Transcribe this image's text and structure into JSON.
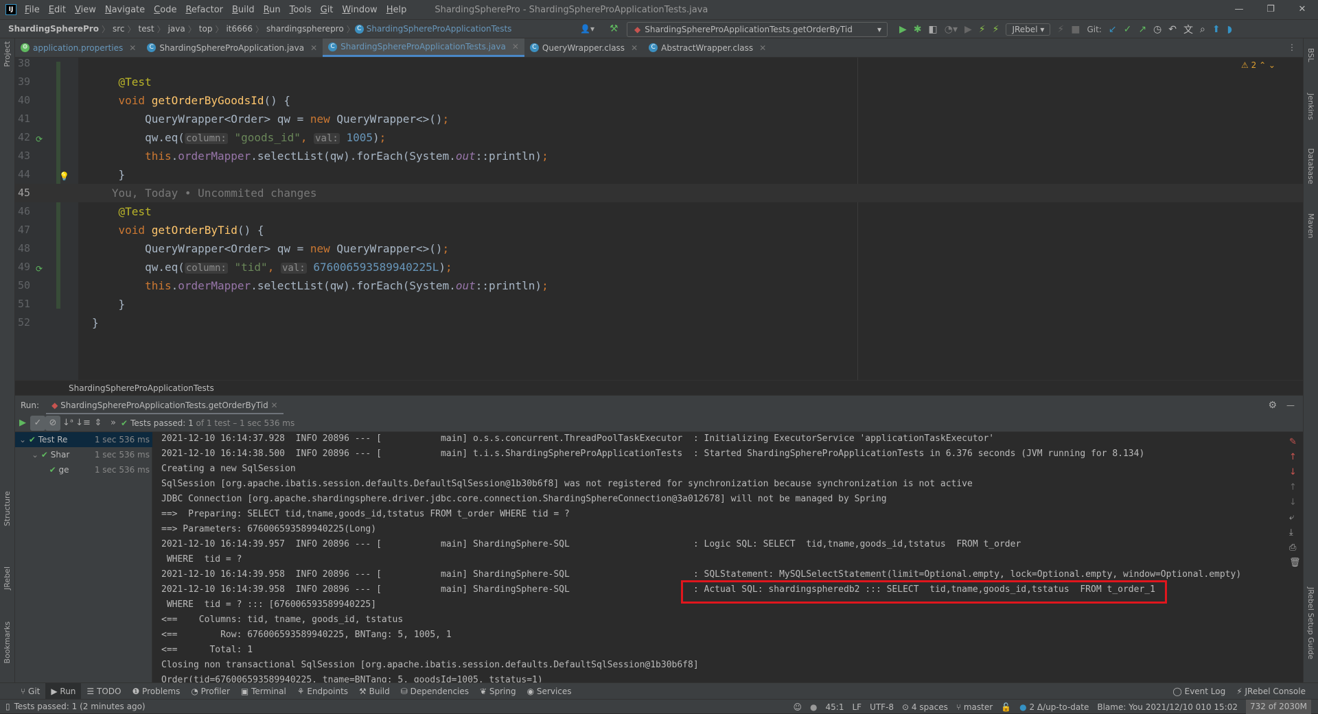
{
  "app": {
    "logo": "IJ",
    "title": "ShardingSpherePro - ShardingSphereProApplicationTests.java"
  },
  "menu": [
    "File",
    "Edit",
    "View",
    "Navigate",
    "Code",
    "Refactor",
    "Build",
    "Run",
    "Tools",
    "Git",
    "Window",
    "Help"
  ],
  "breadcrumb": [
    "ShardingSpherePro",
    "src",
    "test",
    "java",
    "top",
    "it6666",
    "shardingspherepro",
    "ShardingSphereProApplicationTests"
  ],
  "run_config": "ShardingSphereProApplicationTests.getOrderByTid",
  "jrebel_label": "JRebel",
  "git_label": "Git:",
  "tabs": [
    {
      "label": "application.properties",
      "active": false
    },
    {
      "label": "ShardingSphereProApplication.java",
      "active": false
    },
    {
      "label": "ShardingSphereProApplicationTests.java",
      "active": true
    },
    {
      "label": "QueryWrapper.class",
      "active": false
    },
    {
      "label": "AbstractWrapper.class",
      "active": false
    }
  ],
  "left_stripe": [
    "Project",
    "Structure",
    "JRebel",
    "Bookmarks"
  ],
  "right_stripe": [
    "BSL",
    "Jenkins",
    "Database",
    "Maven",
    "JRebel Setup Guide"
  ],
  "editor": {
    "warnings": "2",
    "caret_line": 45,
    "lines": [
      {
        "n": 38,
        "tokens": []
      },
      {
        "n": 39,
        "tokens": [
          [
            "    ",
            ""
          ],
          [
            "@Test",
            "a"
          ]
        ]
      },
      {
        "n": 40,
        "tokens": [
          [
            "    ",
            ""
          ],
          [
            "void ",
            "k"
          ],
          [
            "getOrderByGoodsId",
            "m"
          ],
          [
            "() {",
            ""
          ]
        ]
      },
      {
        "n": 41,
        "tokens": [
          [
            "        QueryWrapper<Order> qw = ",
            ""
          ],
          [
            "new ",
            "k"
          ],
          [
            "QueryWrapper<>()",
            ""
          ],
          [
            ";",
            "k"
          ]
        ]
      },
      {
        "n": 42,
        "tokens": [
          [
            "        qw.eq(",
            ""
          ],
          [
            "column:",
            "h"
          ],
          [
            " ",
            ""
          ],
          [
            "\"goods_id\"",
            "s"
          ],
          [
            ", ",
            "k"
          ],
          [
            "val:",
            "h"
          ],
          [
            " ",
            ""
          ],
          [
            "1005",
            "n"
          ],
          [
            ")",
            ""
          ],
          [
            ";",
            "k"
          ]
        ]
      },
      {
        "n": 43,
        "tokens": [
          [
            "        ",
            ""
          ],
          [
            "this",
            "k"
          ],
          [
            ".",
            ""
          ],
          [
            "orderMapper",
            "f"
          ],
          [
            ".selectList(qw).forEach(System.",
            ""
          ],
          [
            "out",
            "fi"
          ],
          [
            "::println)",
            ""
          ],
          [
            ";",
            "k"
          ]
        ]
      },
      {
        "n": 44,
        "tokens": [
          [
            "    }",
            ""
          ]
        ]
      },
      {
        "n": 45,
        "tokens": [
          [
            "   You, Today • Uncommited changes",
            "b"
          ]
        ]
      },
      {
        "n": 46,
        "tokens": [
          [
            "    ",
            ""
          ],
          [
            "@Test",
            "a"
          ]
        ]
      },
      {
        "n": 47,
        "tokens": [
          [
            "    ",
            ""
          ],
          [
            "void ",
            "k"
          ],
          [
            "getOrderByTid",
            "m"
          ],
          [
            "() {",
            ""
          ]
        ]
      },
      {
        "n": 48,
        "tokens": [
          [
            "        QueryWrapper<Order> qw = ",
            ""
          ],
          [
            "new ",
            "k"
          ],
          [
            "QueryWrapper<>()",
            ""
          ],
          [
            ";",
            "k"
          ]
        ]
      },
      {
        "n": 49,
        "tokens": [
          [
            "        qw.eq(",
            ""
          ],
          [
            "column:",
            "h"
          ],
          [
            " ",
            ""
          ],
          [
            "\"tid\"",
            "s"
          ],
          [
            ", ",
            "k"
          ],
          [
            "val:",
            "h"
          ],
          [
            " ",
            ""
          ],
          [
            "676006593589940225L",
            "n"
          ],
          [
            ")",
            ""
          ],
          [
            ";",
            "k"
          ]
        ]
      },
      {
        "n": 50,
        "tokens": [
          [
            "        ",
            ""
          ],
          [
            "this",
            "k"
          ],
          [
            ".",
            ""
          ],
          [
            "orderMapper",
            "f"
          ],
          [
            ".selectList(qw).forEach(System.",
            ""
          ],
          [
            "out",
            "fi"
          ],
          [
            "::println)",
            ""
          ],
          [
            ";",
            "k"
          ]
        ]
      },
      {
        "n": 51,
        "tokens": [
          [
            "    }",
            ""
          ]
        ]
      },
      {
        "n": 52,
        "tokens": [
          [
            "}",
            ""
          ]
        ]
      }
    ],
    "breadcrumb": "ShardingSphereProApplicationTests"
  },
  "run": {
    "label": "Run:",
    "tab": "ShardingSphereProApplicationTests.getOrderByTid",
    "status_prefix": "Tests passed: ",
    "status_count": "1",
    "status_suffix": " of 1 test – 1 sec 536 ms",
    "tree": [
      {
        "label": "Test Re",
        "duration": "1 sec 536 ms",
        "indent": 0,
        "selected": true
      },
      {
        "label": "Shar",
        "duration": "1 sec 536 ms",
        "indent": 1,
        "selected": false
      },
      {
        "label": "ge",
        "duration": "1 sec 536 ms",
        "indent": 2,
        "selected": false
      }
    ],
    "console": [
      "2021-12-10 16:14:37.928  INFO 20896 --- [           main] o.s.s.concurrent.ThreadPoolTaskExecutor  : Initializing ExecutorService 'applicationTaskExecutor'",
      "2021-12-10 16:14:38.500  INFO 20896 --- [           main] t.i.s.ShardingSphereProApplicationTests  : Started ShardingSphereProApplicationTests in 6.376 seconds (JVM running for 8.134)",
      "Creating a new SqlSession",
      "SqlSession [org.apache.ibatis.session.defaults.DefaultSqlSession@1b30b6f8] was not registered for synchronization because synchronization is not active",
      "JDBC Connection [org.apache.shardingsphere.driver.jdbc.core.connection.ShardingSphereConnection@3a012678] will not be managed by Spring",
      "==>  Preparing: SELECT tid,tname,goods_id,tstatus FROM t_order WHERE tid = ?",
      "==> Parameters: 676006593589940225(Long)",
      "2021-12-10 16:14:39.957  INFO 20896 --- [           main] ShardingSphere-SQL                       : Logic SQL: SELECT  tid,tname,goods_id,tstatus  FROM t_order",
      " WHERE  tid = ?",
      "2021-12-10 16:14:39.958  INFO 20896 --- [           main] ShardingSphere-SQL                       : SQLStatement: MySQLSelectStatement(limit=Optional.empty, lock=Optional.empty, window=Optional.empty)",
      "2021-12-10 16:14:39.958  INFO 20896 --- [           main] ShardingSphere-SQL                       : Actual SQL: shardingspheredb2 ::: SELECT  tid,tname,goods_id,tstatus  FROM t_order_1",
      " WHERE  tid = ? ::: [676006593589940225]",
      "<==    Columns: tid, tname, goods_id, tstatus",
      "<==        Row: 676006593589940225, BNTang: 5, 1005, 1",
      "<==      Total: 1",
      "Closing non transactional SqlSession [org.apache.ibatis.session.defaults.DefaultSqlSession@1b30b6f8]",
      "Order(tid=676006593589940225, tname=BNTang: 5, goodsId=1005, tstatus=1)"
    ],
    "highlight_color": "#e0161d"
  },
  "tool_windows": [
    "Git",
    "Run",
    "TODO",
    "Problems",
    "Profiler",
    "Terminal",
    "Endpoints",
    "Build",
    "Dependencies",
    "Spring",
    "Services"
  ],
  "tool_windows_right": [
    "Event Log",
    "JRebel Console"
  ],
  "status": {
    "message": "Tests passed: 1 (2 minutes ago)",
    "position": "45:1",
    "line_sep": "LF",
    "encoding": "UTF-8",
    "indent": "4 spaces",
    "branch": "master",
    "vcs": "2 Δ/up-to-date",
    "blame": "Blame: You 2021/12/10 010 15:02",
    "memory": "732 of 2030M"
  }
}
